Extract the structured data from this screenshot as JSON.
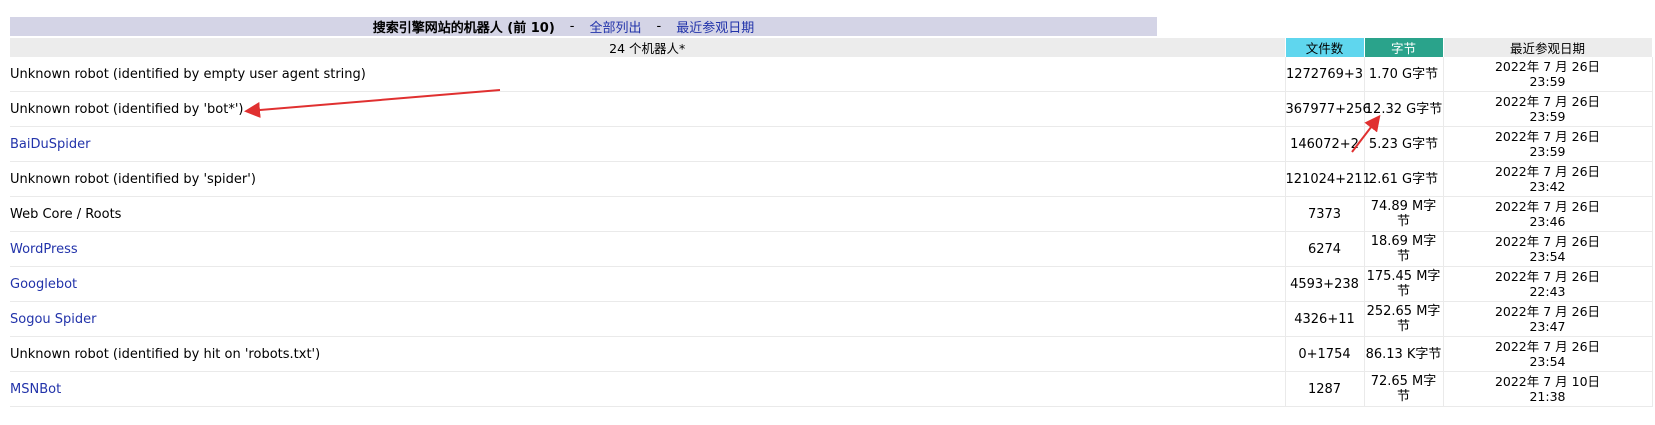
{
  "header": {
    "title": "搜索引擎网站的机器人 (前 10)",
    "separator": "-",
    "list_all": "全部列出",
    "last_visit": "最近参观日期"
  },
  "table": {
    "columns": {
      "name": "24 个机器人*",
      "files": "文件数",
      "bytes": "字节",
      "date": "最近参观日期"
    },
    "rows": [
      {
        "name": "Unknown robot (identified by empty user agent string)",
        "files": "1272769+3",
        "bytes": "1.70 G字节",
        "date1": "2022年 7 月 26日",
        "date2": "23:59",
        "link": false
      },
      {
        "name": "Unknown robot (identified by 'bot*')",
        "files": "367977+256",
        "bytes": "12.32 G字节",
        "date1": "2022年 7 月 26日",
        "date2": "23:59",
        "link": false
      },
      {
        "name": "BaiDuSpider",
        "files": "146072+2",
        "bytes": "5.23 G字节",
        "date1": "2022年 7 月 26日",
        "date2": "23:59",
        "link": true
      },
      {
        "name": "Unknown robot (identified by 'spider')",
        "files": "121024+211",
        "bytes": "2.61 G字节",
        "date1": "2022年 7 月 26日",
        "date2": "23:42",
        "link": false
      },
      {
        "name": "Web Core / Roots",
        "files": "7373",
        "bytes": "74.89 M字节",
        "date1": "2022年 7 月 26日",
        "date2": "23:46",
        "link": false
      },
      {
        "name": "WordPress",
        "files": "6274",
        "bytes": "18.69 M字节",
        "date1": "2022年 7 月 26日",
        "date2": "23:54",
        "link": true
      },
      {
        "name": "Googlebot",
        "files": "4593+238",
        "bytes": "175.45 M字节",
        "date1": "2022年 7 月 26日",
        "date2": "22:43",
        "link": true
      },
      {
        "name": "Sogou Spider",
        "files": "4326+11",
        "bytes": "252.65 M字节",
        "date1": "2022年 7 月 26日",
        "date2": "23:47",
        "link": true
      },
      {
        "name": "Unknown robot (identified by hit on 'robots.txt')",
        "files": "0+1754",
        "bytes": "86.13 K字节",
        "date1": "2022年 7 月 26日",
        "date2": "23:54",
        "link": false
      },
      {
        "name": "MSNBot",
        "files": "1287",
        "bytes": "72.65 M字节",
        "date1": "2022年 7 月 10日",
        "date2": "21:38",
        "link": true
      }
    ]
  },
  "colors": {
    "header_bg": "#d4d4e6",
    "files_header": "#5fd6ee",
    "bytes_header": "#2aa38b",
    "link": "#2233aa",
    "annotation_arrow": "#e03030"
  }
}
